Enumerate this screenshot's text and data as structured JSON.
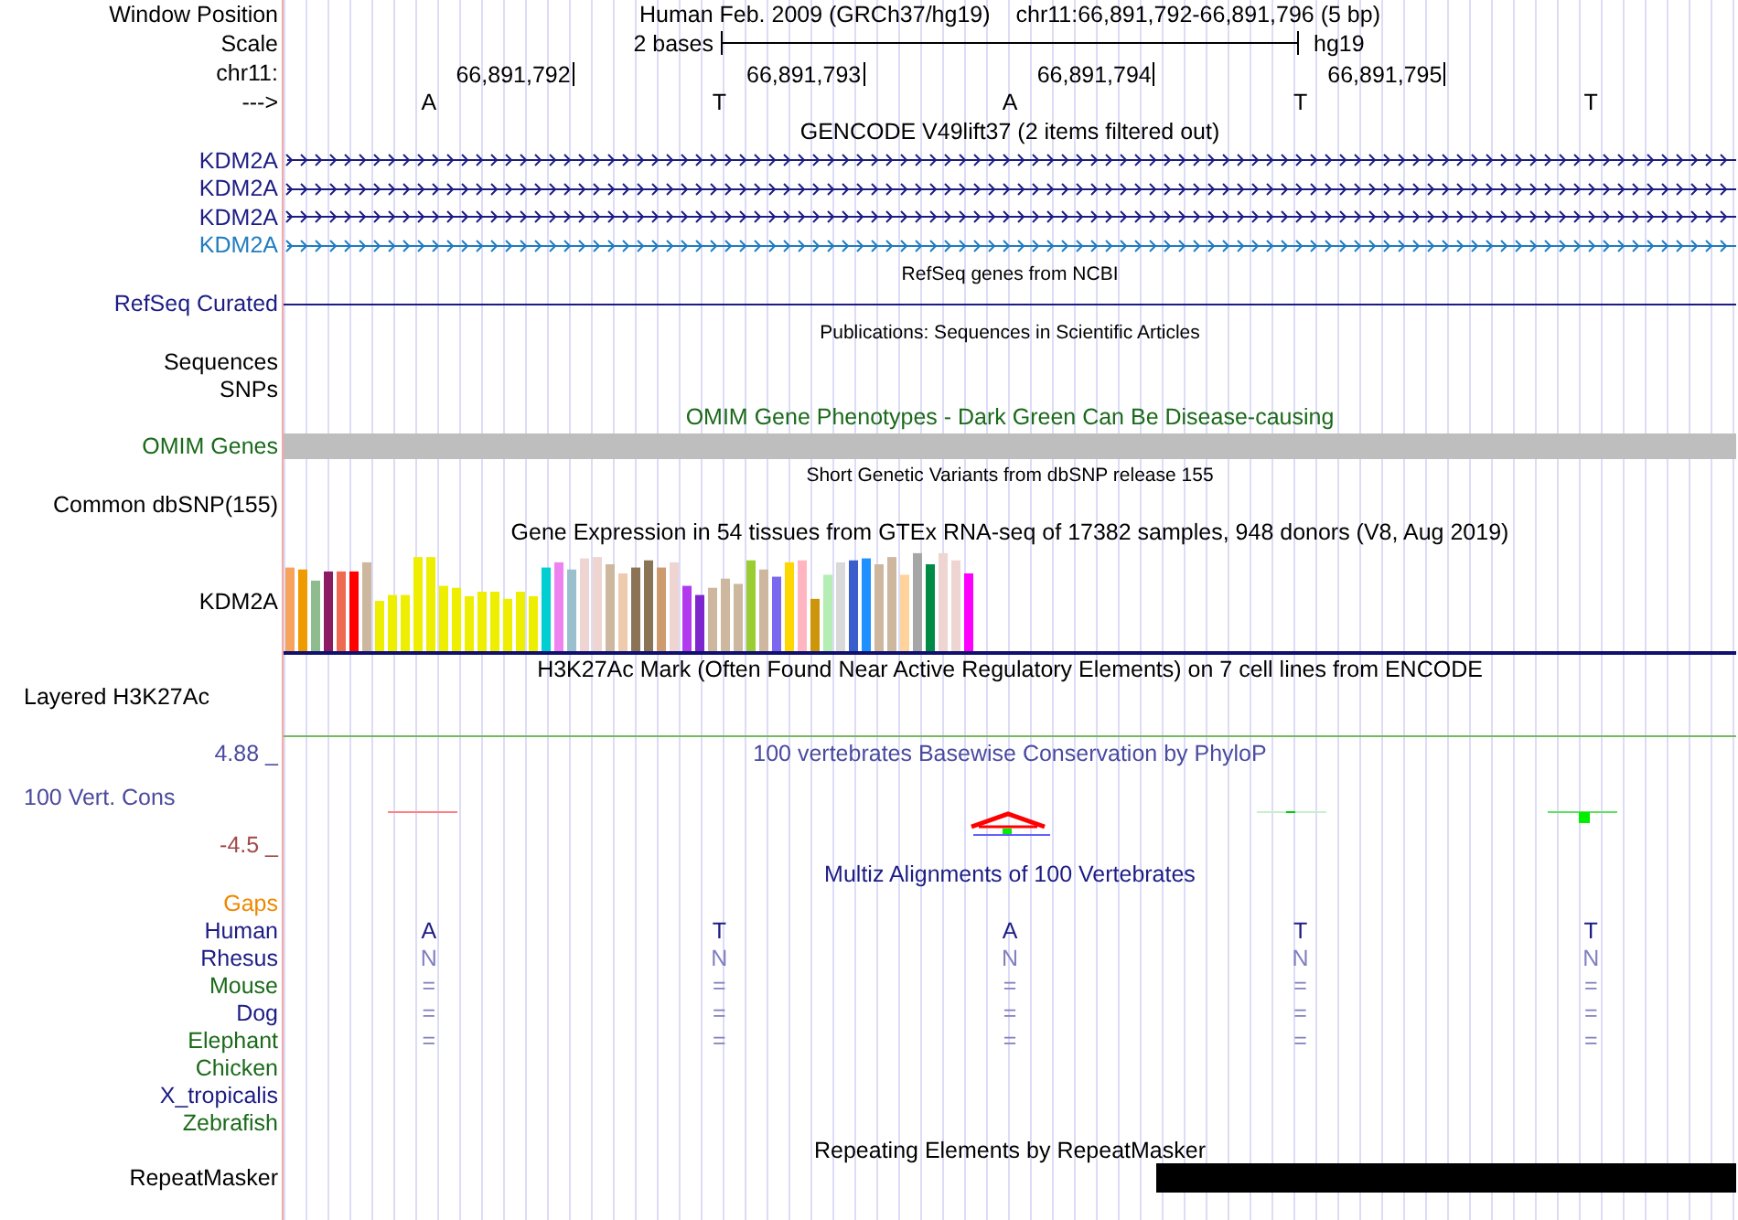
{
  "window_position": {
    "label": "Window Position",
    "assembly": "Human Feb. 2009 (GRCh37/hg19)",
    "position": "chr11:66,891,792-66,891,796 (5 bp)"
  },
  "scale": {
    "label": "Scale",
    "span": "2 bases",
    "assembly": "hg19"
  },
  "ruler": {
    "label": "chr11:",
    "ticks": [
      "66,891,792",
      "66,891,793",
      "66,891,794",
      "66,891,795"
    ]
  },
  "strand": {
    "label": "--->",
    "bases": [
      "A",
      "T",
      "A",
      "T",
      "T"
    ]
  },
  "tracks": [
    {
      "kind": "genes",
      "title": "GENCODE V49lift37 (2 items filtered out)",
      "items": [
        {
          "label": "KDM2A",
          "color": "#1c1c84"
        },
        {
          "label": "KDM2A",
          "color": "#1c1c84"
        },
        {
          "label": "KDM2A",
          "color": "#1c1c84"
        },
        {
          "label": "KDM2A",
          "color": "#1f7cc0"
        }
      ]
    },
    {
      "kind": "line",
      "title": "RefSeq genes from NCBI",
      "label": "RefSeq Curated"
    },
    {
      "kind": "empty",
      "title": "Publications: Sequences in Scientific Articles",
      "labels": [
        "Sequences",
        "SNPs"
      ]
    },
    {
      "kind": "bar",
      "title": "OMIM Gene Phenotypes - Dark Green Can Be Disease-causing",
      "label": "OMIM Genes"
    },
    {
      "kind": "empty",
      "title": "Short Genetic Variants from dbSNP release 155",
      "labels": [
        "Common dbSNP(155)"
      ]
    },
    {
      "kind": "expression",
      "title": "Gene Expression in 54 tissues from GTEx RNA-seq of 17382 samples, 948 donors (V8, Aug 2019)",
      "label": "KDM2A"
    },
    {
      "kind": "layered",
      "title": "H3K27Ac Mark (Often Found Near Active Regulatory Elements) on 7 cell lines from ENCODE",
      "label": "Layered H3K27Ac"
    },
    {
      "kind": "conservation",
      "title": "100 vertebrates Basewise Conservation by PhyloP",
      "label": "100 Vert. Cons",
      "max": "4.88 _",
      "min": "-4.5 _"
    },
    {
      "kind": "alignment",
      "title": "Multiz Alignments of 100 Vertebrates",
      "species": [
        {
          "name": "Gaps",
          "color": "#ee8800",
          "kind": "empty"
        },
        {
          "name": "Human",
          "color": "#1c1c84",
          "kind": "reference",
          "bases": [
            "A",
            "T",
            "A",
            "T",
            "T"
          ]
        },
        {
          "name": "Rhesus",
          "color": "#1c1c84",
          "kind": "aligned",
          "bases": [
            "N",
            "N",
            "N",
            "N",
            "N"
          ]
        },
        {
          "name": "Mouse",
          "color": "#1a6a1a",
          "kind": "aligned",
          "bases": [
            "=",
            "=",
            "=",
            "=",
            "="
          ]
        },
        {
          "name": "Dog",
          "color": "#1c1c84",
          "kind": "aligned",
          "bases": [
            "=",
            "=",
            "=",
            "=",
            "="
          ]
        },
        {
          "name": "Elephant",
          "color": "#1a6a1a",
          "kind": "aligned",
          "bases": [
            "=",
            "=",
            "=",
            "=",
            "="
          ]
        },
        {
          "name": "Chicken",
          "color": "#1a6a1a",
          "kind": "empty"
        },
        {
          "name": "X_tropicalis",
          "color": "#1c1c84",
          "kind": "empty"
        },
        {
          "name": "Zebrafish",
          "color": "#1a6a1a",
          "kind": "empty"
        }
      ]
    },
    {
      "kind": "repeats",
      "title": "Repeating Elements by RepeatMasker",
      "label": "RepeatMasker"
    }
  ]
}
